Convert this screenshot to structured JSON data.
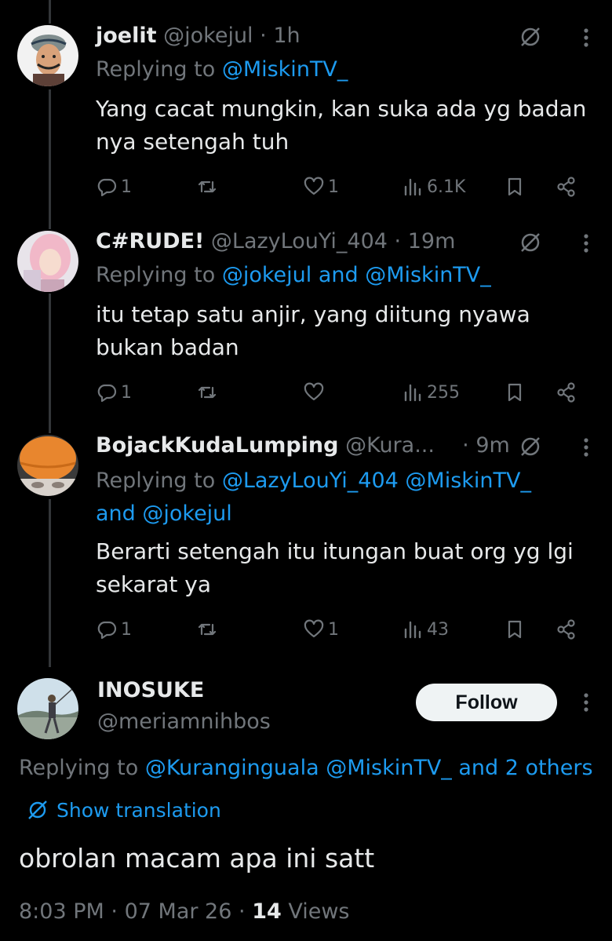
{
  "replies": [
    {
      "name": "joelit",
      "handle": "@jokejul",
      "sep": "·",
      "time": "1h",
      "replying_prefix": "Replying to ",
      "replying_mentions": "@MiskinTV_",
      "replying_line2": "",
      "text": "Yang cacat mungkin, kan suka ada yg badan nya setengah tuh",
      "replies_count": "1",
      "reposts_count": "",
      "likes_count": "1",
      "views_count": "6.1K"
    },
    {
      "name": "C#RUDE!",
      "handle": "@LazyLouYi_404",
      "sep": "·",
      "time": "19m",
      "replying_prefix": "Replying to ",
      "replying_mentions": "@jokejul and @MiskinTV_",
      "replying_line2": "",
      "text": "itu tetap satu anjir, yang diitung nyawa bukan badan",
      "replies_count": "1",
      "reposts_count": "",
      "likes_count": "",
      "views_count": "255"
    },
    {
      "name": "BojackKudaLumping",
      "handle": "@Kura...",
      "sep": "·",
      "time": "9m",
      "replying_prefix": "Replying to ",
      "replying_mentions": "@LazyLouYi_404 @MiskinTV_",
      "replying_line2": "and @jokejul",
      "text": "Berarti setengah itu itungan buat org yg lgi sekarat ya",
      "replies_count": "1",
      "reposts_count": "",
      "likes_count": "1",
      "views_count": "43"
    }
  ],
  "main": {
    "name": "INOSUKE",
    "handle": "@meriamnihbos",
    "follow_label": "Follow",
    "replying_prefix": "Replying to ",
    "replying_mentions": "@Kuranginguala @MiskinTV_ and 2 others",
    "show_translation": "Show translation",
    "text": "obrolan macam apa ini satt",
    "time": "8:03 PM",
    "sep": "·",
    "date": "07 Mar 26",
    "views_count": "14",
    "views_label": "Views"
  },
  "colors": {
    "background": "#000000",
    "text": "#e7e9ea",
    "muted": "#71767b",
    "accent": "#1d9bf0",
    "thread_line": "#333639"
  },
  "icons": [
    "grok-icon",
    "more-icon",
    "reply-icon",
    "repost-icon",
    "like-icon",
    "views-icon",
    "bookmark-icon",
    "share-icon",
    "translate-icon"
  ]
}
